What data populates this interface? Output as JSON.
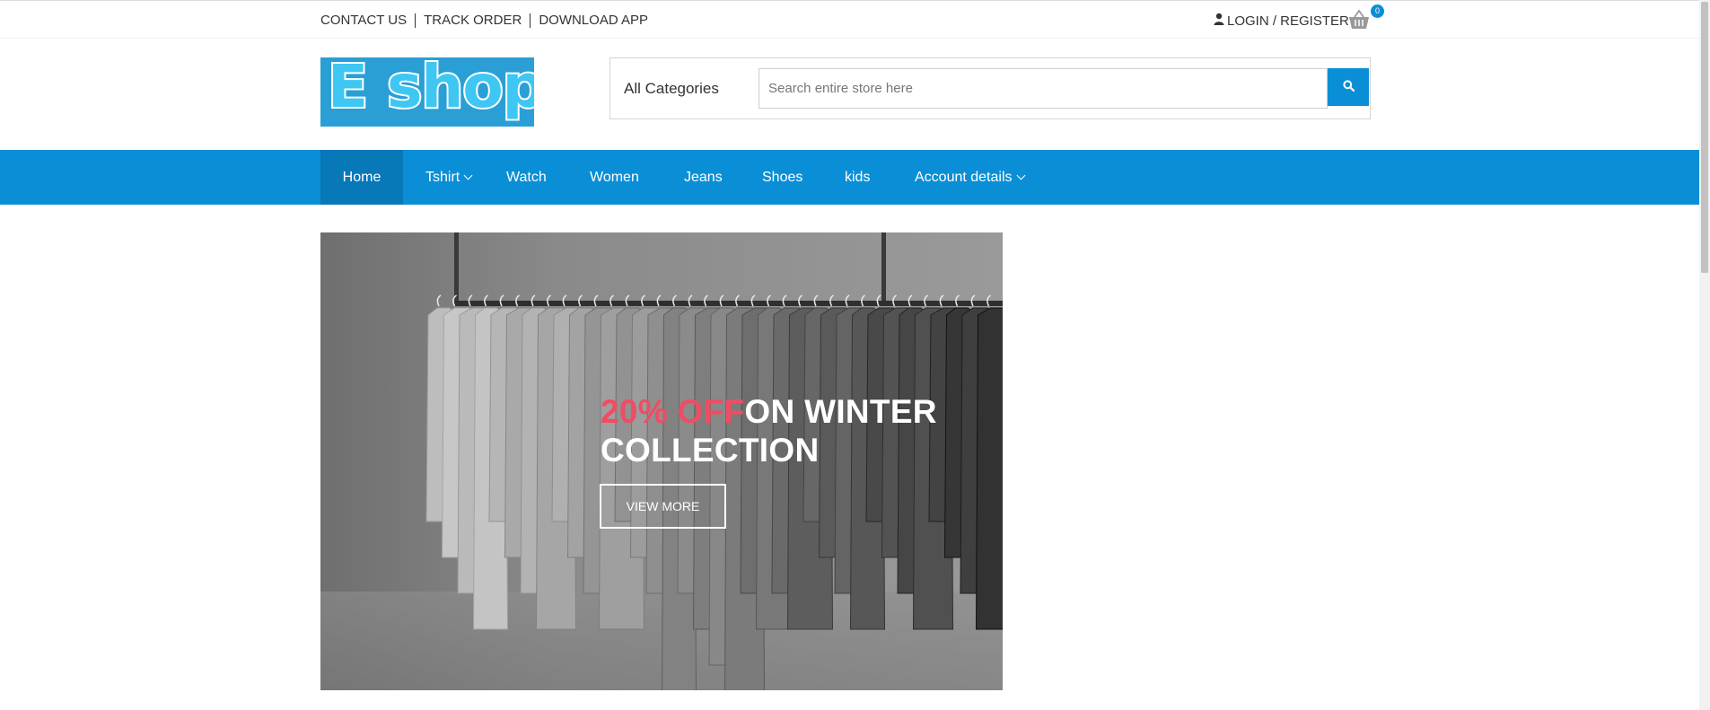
{
  "topbar": {
    "links": [
      "CONTACT US",
      "TRACK ORDER",
      "DOWNLOAD APP"
    ],
    "auth_label": "LOGIN / REGISTER",
    "cart_count": "0",
    "icons": {
      "user": "user-icon",
      "cart": "basket-icon"
    }
  },
  "brand": {
    "logo_text": "E shop"
  },
  "search": {
    "category": "All Categories",
    "placeholder": "Search entire store here",
    "button_icon": "search-icon"
  },
  "nav": {
    "items": [
      {
        "label": "Home",
        "active": true
      },
      {
        "label": "Tshirt",
        "dropdown": true
      },
      {
        "label": "Watch"
      },
      {
        "label": "Women"
      },
      {
        "label": "Jeans"
      },
      {
        "label": "Shoes"
      },
      {
        "label": "kids"
      },
      {
        "label": "Account details",
        "dropdown": true
      }
    ]
  },
  "banner": {
    "highlight": "20% OFF",
    "headline_rest": "ON WINTER",
    "headline_line2": "COLLECTION",
    "button_label": "VIEW MORE"
  },
  "colors": {
    "accent": "#0a8fd6",
    "nav_active": "#0778b8",
    "highlight": "#ef4d63"
  }
}
